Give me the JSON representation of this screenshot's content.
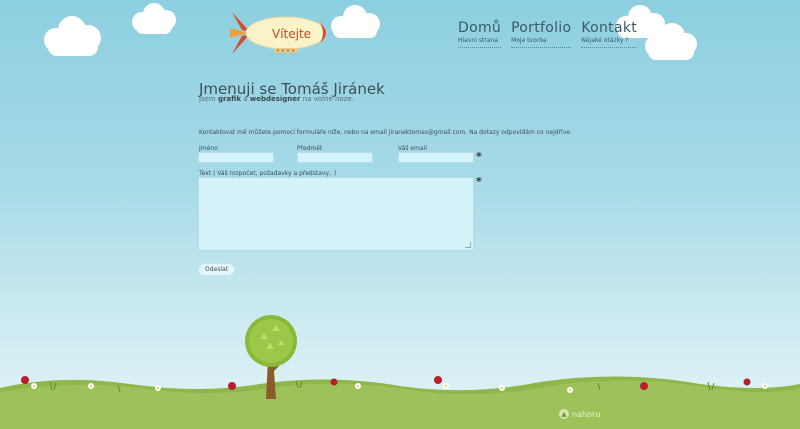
{
  "blimp": {
    "label": "Vítejte"
  },
  "nav": [
    {
      "title": "Domů",
      "subtitle": "Hlavní strana"
    },
    {
      "title": "Portfolio",
      "subtitle": "Moje tvorba"
    },
    {
      "title": "Kontakt",
      "subtitle": "Nějaké otázky ?"
    }
  ],
  "header": {
    "name": "Jmenuji se Tomáš Jiránek",
    "tagline_pre": "jsem ",
    "tagline_b1": "grafik",
    "tagline_mid": " a ",
    "tagline_b2": "webdesigner",
    "tagline_post": " na volné noze."
  },
  "intro": "Kontaktovat mě můžete pomocí formuláře níže, nebo na email jiranektomas@gmail.com. Na dotazy odpovídám co nejdříve.",
  "form": {
    "name_label": "Jméno",
    "subject_label": "Předmět",
    "email_label": "Váš email",
    "text_label": "Text ( Váš rozpočet, požadavky a představy.. )",
    "required_mark": "*",
    "submit_label": "Odeslat"
  },
  "footer": {
    "top_label": "nahoru"
  },
  "colors": {
    "sky_top": "#8ccfe0",
    "field_bg": "#d3f3f8",
    "grass": "#9dc25a",
    "accent_red": "#c24a2a"
  }
}
